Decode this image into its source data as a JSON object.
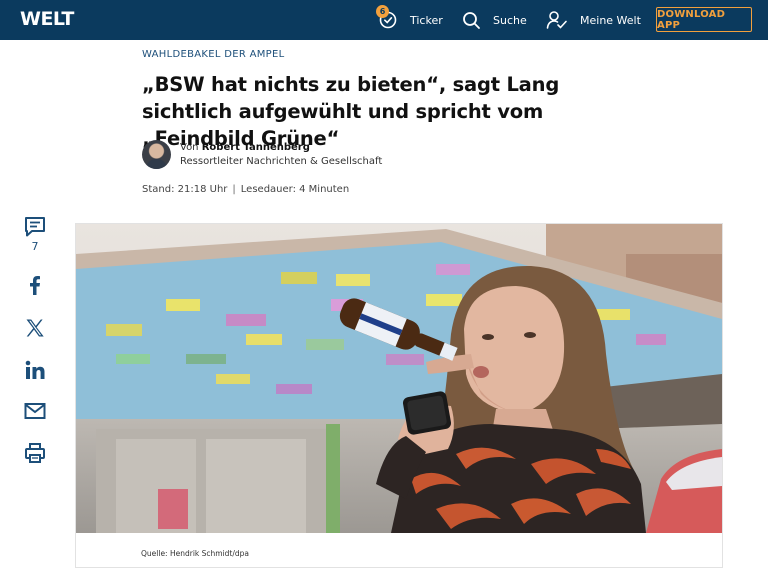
{
  "header": {
    "logo": "WELT",
    "ticker": {
      "label": "Ticker",
      "badge": "6"
    },
    "search_label": "Suche",
    "meine_welt_label": "Meine Welt",
    "download_label": "DOWNLOAD APP"
  },
  "article": {
    "kicker": "WAHLDEBAKEL DER AMPEL",
    "headline": "„BSW hat nichts zu bieten“, sagt Lang sichtlich aufgewühlt und spricht vom „Feindbild Grüne“",
    "author_prefix": "Von",
    "author_name": "Robert Tannenberg",
    "author_role": "Ressortleiter Nachrichten & Gesellschaft",
    "stand": "Stand: 21:18 Uhr",
    "lesedauer": "Lesedauer: 4 Minuten",
    "image_caption": "Quelle: Hendrik Schmidt/dpa"
  },
  "share": {
    "comments_count": "7",
    "icons": [
      "comment-icon",
      "facebook-icon",
      "x-icon",
      "linkedin-icon",
      "mail-icon",
      "print-icon"
    ]
  },
  "colors": {
    "brand_navy": "#0b3a5e",
    "accent_orange": "#f2a03d",
    "kicker_blue": "#1d4f7a"
  }
}
